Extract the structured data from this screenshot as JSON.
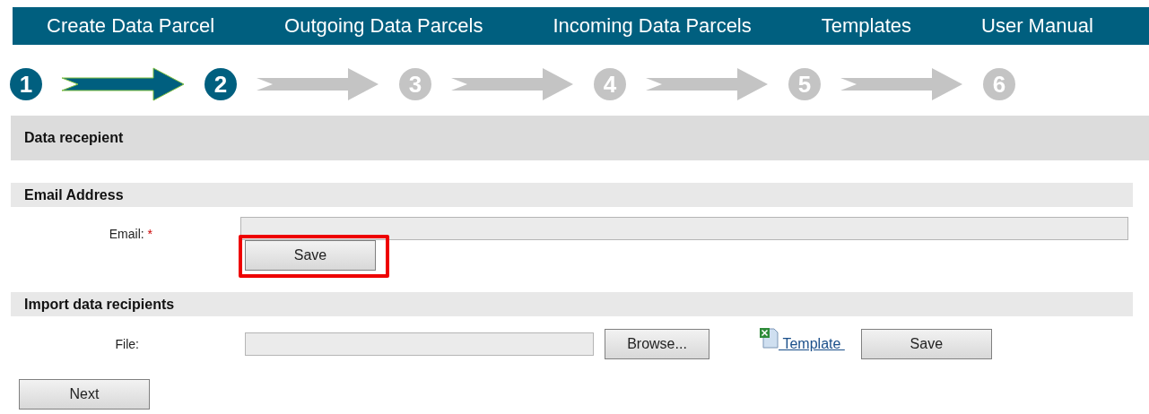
{
  "nav": [
    "Create Data Parcel",
    "Outgoing Data Parcels",
    "Incoming Data Parcels",
    "Templates",
    "User Manual"
  ],
  "steps": [
    {
      "label": "1",
      "done": true
    },
    {
      "label": "2",
      "done": true
    },
    {
      "label": "3",
      "done": false
    },
    {
      "label": "4",
      "done": false
    },
    {
      "label": "5",
      "done": false
    },
    {
      "label": "6",
      "done": false
    }
  ],
  "page_title": "Data recepient",
  "email_section": {
    "title": "Email Address",
    "label": "Email:",
    "required_mark": "*",
    "save_button": {
      "label": "Save",
      "highlighted": true
    }
  },
  "import_section": {
    "title": "Import data recipients",
    "label": "File:",
    "browse_button": "Browse...",
    "template_link": "Template",
    "save_button": "Save"
  },
  "next_button": "Next"
}
